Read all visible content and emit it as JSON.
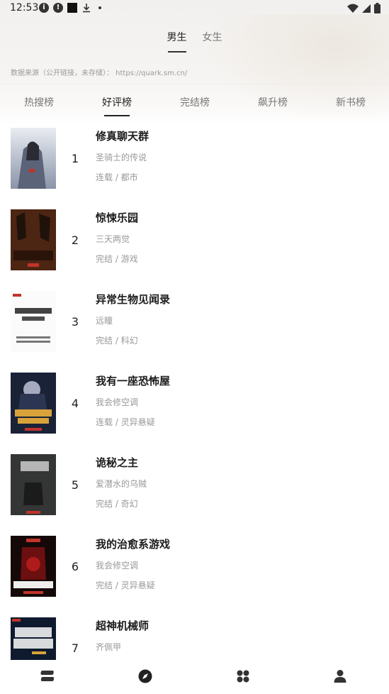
{
  "status_bar": {
    "time": "12:53"
  },
  "gender_tabs": [
    {
      "label": "男生",
      "active": true
    },
    {
      "label": "女生",
      "active": false
    }
  ],
  "source_note": "数据来源（公开链接，未存储）：  https://quark.sm.cn/",
  "rank_tabs": [
    {
      "label": "热搜榜",
      "active": false
    },
    {
      "label": "好评榜",
      "active": true
    },
    {
      "label": "完结榜",
      "active": false
    },
    {
      "label": "飙升榜",
      "active": false
    },
    {
      "label": "新书榜",
      "active": false
    }
  ],
  "books": [
    {
      "rank": "1",
      "title": "修真聊天群",
      "author": "圣骑士的传说",
      "meta": "连载 / 都市",
      "cover_text": "修真聊天群"
    },
    {
      "rank": "2",
      "title": "惊悚乐园",
      "author": "三天两觉",
      "meta": "完结 / 游戏",
      "cover_text": "惊悚乐园"
    },
    {
      "rank": "3",
      "title": "异常生物见闻录",
      "author": "远瞳",
      "meta": "完结 / 科幻",
      "cover_text": "异常生物 见闻录"
    },
    {
      "rank": "4",
      "title": "我有一座恐怖屋",
      "author": "我会修空调",
      "meta": "连载 / 灵异悬疑",
      "cover_text": "我家大是 金融大和"
    },
    {
      "rank": "5",
      "title": "诡秘之主",
      "author": "爱潜水的乌贼",
      "meta": "完结 / 奇幻",
      "cover_text": "诡秘之主"
    },
    {
      "rank": "6",
      "title": "我的治愈系游戏",
      "author": "我会修空调",
      "meta": "完结 / 灵异悬疑",
      "cover_text": "我的治愈系游戏"
    },
    {
      "rank": "7",
      "title": "超神机械师",
      "author": "齐佩甲",
      "meta": "",
      "cover_text": "超神 机械师"
    }
  ],
  "bottom_nav": [
    {
      "icon": "bookshelf-icon"
    },
    {
      "icon": "discover-compass-icon",
      "active": true
    },
    {
      "icon": "category-grid-icon"
    },
    {
      "icon": "profile-icon"
    }
  ],
  "colors": {
    "accent": "#222222",
    "muted": "#999999"
  }
}
